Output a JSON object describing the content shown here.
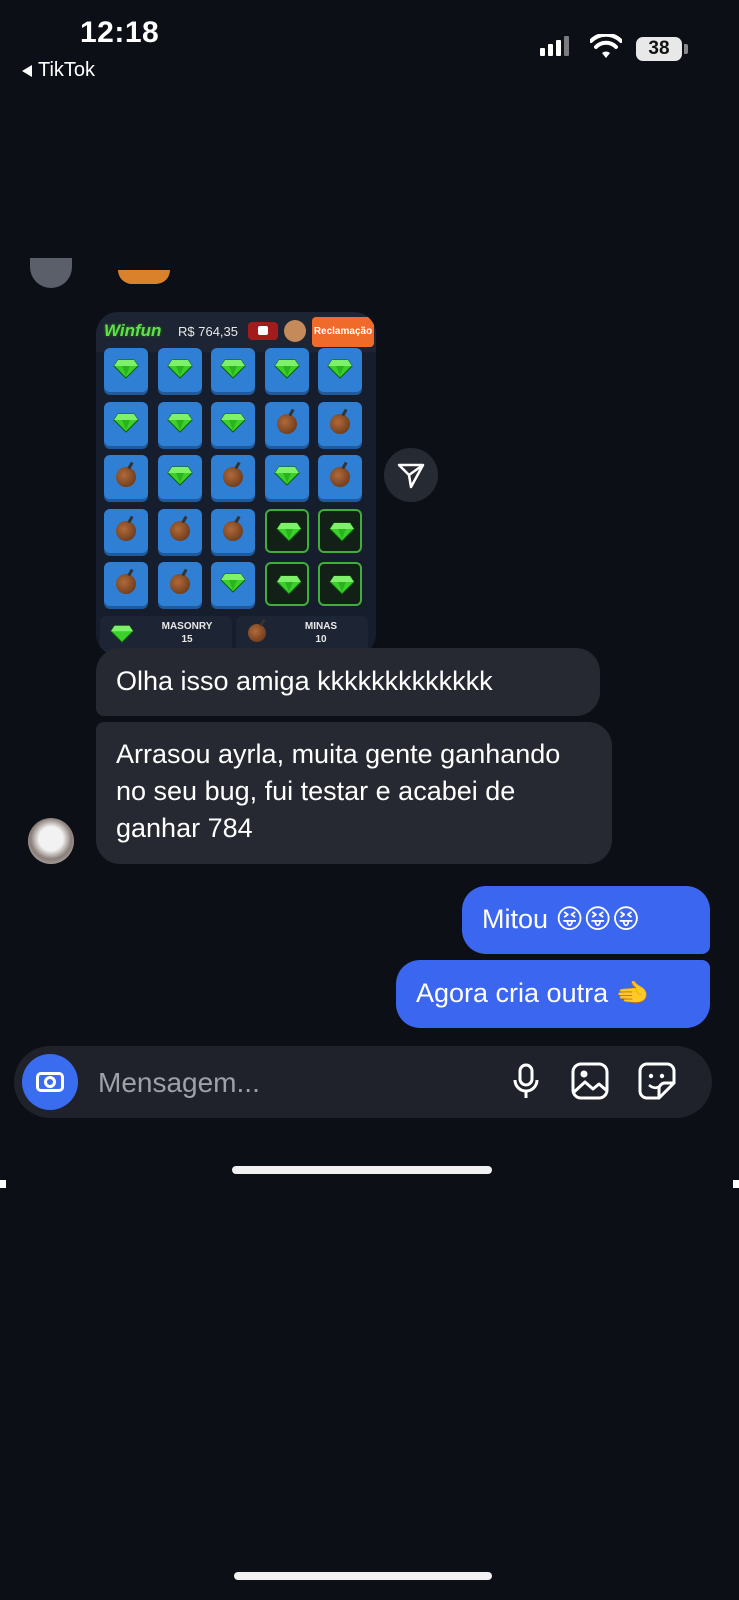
{
  "status_bar": {
    "time": "12:18",
    "back_app": "TikTok",
    "battery": "38",
    "icons": [
      "signal-icon",
      "wifi-icon",
      "battery-icon"
    ]
  },
  "shared_screenshot": {
    "logo": "Winfun",
    "balance": "R$ 764,35",
    "complaint_button": "Reclamação",
    "grid": [
      [
        "gem",
        "gem",
        "gem",
        "gem",
        "gem"
      ],
      [
        "gem",
        "gem",
        "gem",
        "bomb",
        "bomb"
      ],
      [
        "bomb",
        "gem",
        "bomb",
        "gem",
        "bomb"
      ],
      [
        "bomb",
        "bomb",
        "bomb",
        "gem-revealed",
        "gem-revealed"
      ],
      [
        "bomb",
        "bomb",
        "gem",
        "gem-revealed",
        "gem-revealed"
      ]
    ],
    "footer": {
      "gems_label": "MASONRY",
      "gems_count": "15",
      "mines_label": "MINAS",
      "mines_count": "10"
    }
  },
  "messages": {
    "incoming": [
      "Olha isso amiga kkkkkkkkkkkkk",
      "Arrasou ayrla, muita gente ganhando no seu bug, fui testar e acabei de ganhar 784"
    ],
    "outgoing": [
      "Mitou 😝😝😝",
      "Agora cria outra 🫲"
    ]
  },
  "composer": {
    "placeholder": "Mensagem...",
    "icons": [
      "camera-icon",
      "microphone-icon",
      "gallery-icon",
      "sticker-icon"
    ]
  },
  "colors": {
    "background": "#0c0f16",
    "incoming_bubble": "#262931",
    "outgoing_bubble": "#3b66f0",
    "accent": "#3a6cf0"
  }
}
